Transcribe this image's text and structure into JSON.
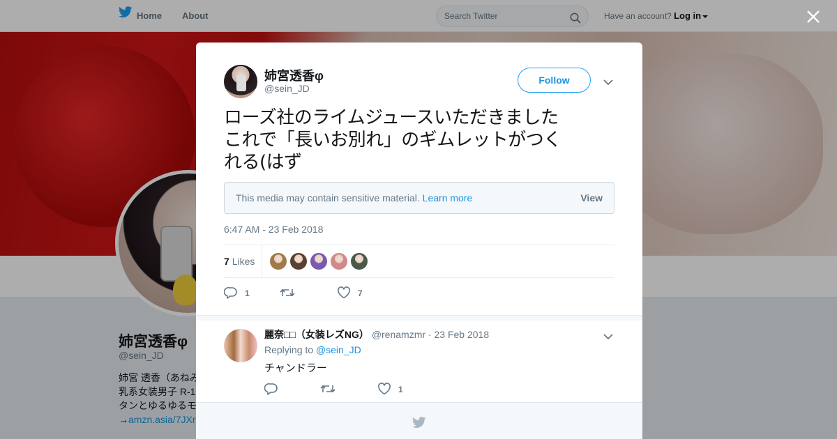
{
  "topbar": {
    "home_label": "Home",
    "about_label": "About",
    "search_placeholder": "Search Twitter",
    "account_prompt": "Have an account?",
    "login_label": "Log in"
  },
  "profile": {
    "name": "姉宮透香φ",
    "handle": "@sein_JD",
    "bio_lines": [
      "姉宮 透香（あねみ",
      "乳系女装男子 R-1",
      "タンとゆるゆるモ"
    ],
    "bio_link_prefix": "→",
    "bio_link": "amzn.asia/7JXr"
  },
  "tweet": {
    "author_name": "姉宮透香φ",
    "author_handle": "@sein_JD",
    "follow_label": "Follow",
    "text_lines": [
      "ローズ社のライムジュースいただきました",
      "これで「長いお別れ」のギムレットがつく",
      "れる(はず"
    ],
    "sensitive_notice": "This media may contain sensitive material.",
    "learn_more_label": "Learn more",
    "view_label": "View",
    "timestamp": "6:47 AM - 23 Feb 2018",
    "likes_count": "7",
    "likes_label": "Likes",
    "reply_count": "1",
    "retweet_count": "",
    "like_count": "7",
    "likers": [
      {
        "icon": "liker-avatar-1",
        "color": "#a07a4a"
      },
      {
        "icon": "liker-avatar-2",
        "color": "#5a4030"
      },
      {
        "icon": "liker-avatar-3",
        "color": "#7a5ab0"
      },
      {
        "icon": "liker-avatar-4",
        "color": "#d08a8a"
      },
      {
        "icon": "liker-avatar-5",
        "color": "#4a5a4a"
      }
    ]
  },
  "reply": {
    "name": "麗奈",
    "name_suffix": "（女装レズNG）",
    "handle": "@renamzmr",
    "date": "23 Feb 2018",
    "replying_prefix": "Replying to",
    "replying_to": "@sein_JD",
    "text": "チャンドラー",
    "reply_count": "",
    "retweet_count": "",
    "like_count": "1"
  },
  "colors": {
    "brand": "#1da1f2",
    "link": "#1b95e0",
    "secondary_text": "#657786"
  }
}
